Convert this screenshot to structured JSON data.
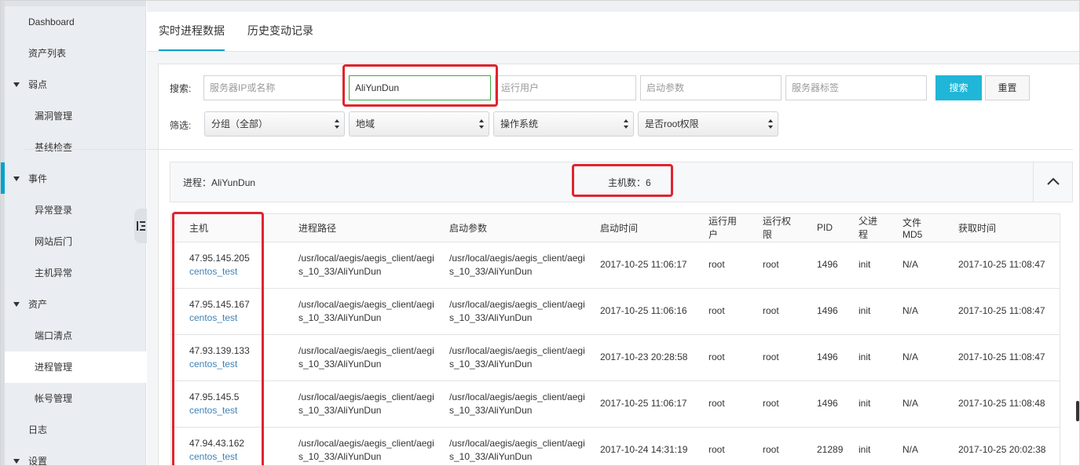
{
  "sidebar": {
    "items": [
      {
        "label": "Dashboard",
        "kind": "top"
      },
      {
        "label": "资产列表",
        "kind": "top"
      },
      {
        "label": "弱点",
        "kind": "group"
      },
      {
        "label": "漏洞管理",
        "kind": "sub"
      },
      {
        "label": "基线检查",
        "kind": "sub"
      },
      {
        "label": "事件",
        "kind": "group"
      },
      {
        "label": "异常登录",
        "kind": "sub"
      },
      {
        "label": "网站后门",
        "kind": "sub"
      },
      {
        "label": "主机异常",
        "kind": "sub"
      },
      {
        "label": "资产",
        "kind": "group"
      },
      {
        "label": "端口清点",
        "kind": "sub"
      },
      {
        "label": "进程管理",
        "kind": "sub",
        "active": true
      },
      {
        "label": "帐号管理",
        "kind": "sub"
      },
      {
        "label": "日志",
        "kind": "top"
      },
      {
        "label": "设置",
        "kind": "group"
      }
    ]
  },
  "tabs": [
    {
      "label": "实时进程数据",
      "active": true
    },
    {
      "label": "历史变动记录",
      "active": false
    }
  ],
  "search": {
    "label": "搜索:",
    "ip_placeholder": "服务器IP或名称",
    "process_value": "AliYunDun",
    "user_placeholder": "运行用户",
    "args_placeholder": "启动参数",
    "tag_placeholder": "服务器标签",
    "search_button": "搜索",
    "reset_button": "重置"
  },
  "filter": {
    "label": "筛选:",
    "group": "分组（全部）",
    "region": "地域",
    "os": "操作系统",
    "root": "是否root权限"
  },
  "process_header": {
    "process_text": "进程：AliYunDun",
    "host_count_text": "主机数：6"
  },
  "table": {
    "columns": [
      "主机",
      "进程路径",
      "启动参数",
      "启动时间",
      "运行用户",
      "运行权限",
      "PID",
      "父进程",
      "文件MD5",
      "获取时间"
    ],
    "rows": [
      {
        "ip": "47.95.145.205",
        "name": "centos_test",
        "path1": "/usr/local/aegis/aegis_client/aegi",
        "path2": "s_10_33/AliYunDun",
        "args1": "/usr/local/aegis/aegis_client/aegi",
        "args2": "s_10_33/AliYunDun",
        "start": "2017-10-25 11:06:17",
        "user": "root",
        "priv": "root",
        "pid": "1496",
        "parent": "init",
        "md5": "N/A",
        "fetched": "2017-10-25 11:08:47"
      },
      {
        "ip": "47.95.145.167",
        "name": "centos_test",
        "path1": "/usr/local/aegis/aegis_client/aegi",
        "path2": "s_10_33/AliYunDun",
        "args1": "/usr/local/aegis/aegis_client/aegi",
        "args2": "s_10_33/AliYunDun",
        "start": "2017-10-25 11:06:16",
        "user": "root",
        "priv": "root",
        "pid": "1496",
        "parent": "init",
        "md5": "N/A",
        "fetched": "2017-10-25 11:08:47"
      },
      {
        "ip": "47.93.139.133",
        "name": "centos_test",
        "path1": "/usr/local/aegis/aegis_client/aegi",
        "path2": "s_10_33/AliYunDun",
        "args1": "/usr/local/aegis/aegis_client/aegi",
        "args2": "s_10_33/AliYunDun",
        "start": "2017-10-23 20:28:58",
        "user": "root",
        "priv": "root",
        "pid": "1496",
        "parent": "init",
        "md5": "N/A",
        "fetched": "2017-10-25 11:08:47"
      },
      {
        "ip": "47.95.145.5",
        "name": "centos_test",
        "path1": "/usr/local/aegis/aegis_client/aegi",
        "path2": "s_10_33/AliYunDun",
        "args1": "/usr/local/aegis/aegis_client/aegi",
        "args2": "s_10_33/AliYunDun",
        "start": "2017-10-25 11:06:17",
        "user": "root",
        "priv": "root",
        "pid": "1496",
        "parent": "init",
        "md5": "N/A",
        "fetched": "2017-10-25 11:08:48"
      },
      {
        "ip": "47.94.43.162",
        "name": "centos_test",
        "path1": "/usr/local/aegis/aegis_client/aegi",
        "path2": "s_10_33/AliYunDun",
        "args1": "/usr/local/aegis/aegis_client/aegi",
        "args2": "s_10_33/AliYunDun",
        "start": "2017-10-24 14:31:19",
        "user": "root",
        "priv": "root",
        "pid": "21289",
        "parent": "init",
        "md5": "N/A",
        "fetched": "2017-10-25 20:02:38"
      }
    ]
  },
  "colors": {
    "accent": "#00a2ca",
    "primary_button": "#1fb6d8",
    "highlight_box": "#e0242e",
    "link": "#3d82b8"
  }
}
